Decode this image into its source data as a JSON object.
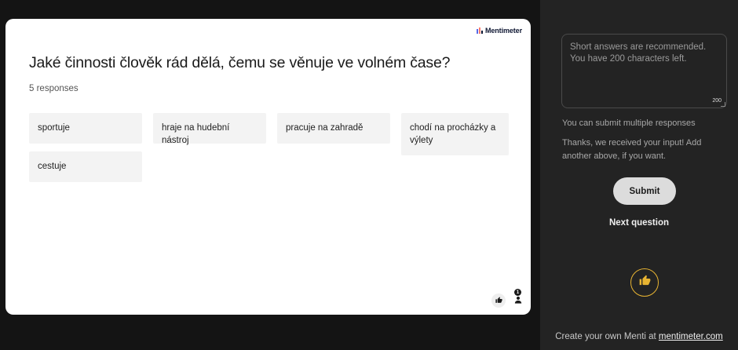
{
  "slide": {
    "brand": "Mentimeter",
    "question": "Jaké činnosti člověk rád dělá, čemu se věnuje ve volném čase?",
    "responses_count": "5 responses",
    "answers": [
      "sportuje",
      "hraje na hudební nástroj",
      "pracuje na zahradě",
      "chodí na procházky a výlety",
      "cestuje"
    ],
    "participants_badge": "1",
    "icons": [
      "thumbs-up-icon",
      "person-icon"
    ]
  },
  "panel": {
    "answer_placeholder": "Short answers are recommended. You have 200 characters left.",
    "char_count": "200",
    "hint": "You can submit multiple responses",
    "thanks": "Thanks, we received your input! Add another above, if you want.",
    "submit_label": "Submit",
    "next_question_label": "Next question",
    "reaction_icon": "thumbs-up-icon",
    "reaction_color": "#e8b432",
    "footer_text": "Create your own Menti at ",
    "footer_link": "mentimeter.com"
  },
  "colors": {
    "page_bg": "#141414",
    "panel_bg": "#232323",
    "slide_bg": "#ffffff",
    "answer_bg": "#f3f3f3",
    "submit_bg": "#dcdcdc"
  }
}
